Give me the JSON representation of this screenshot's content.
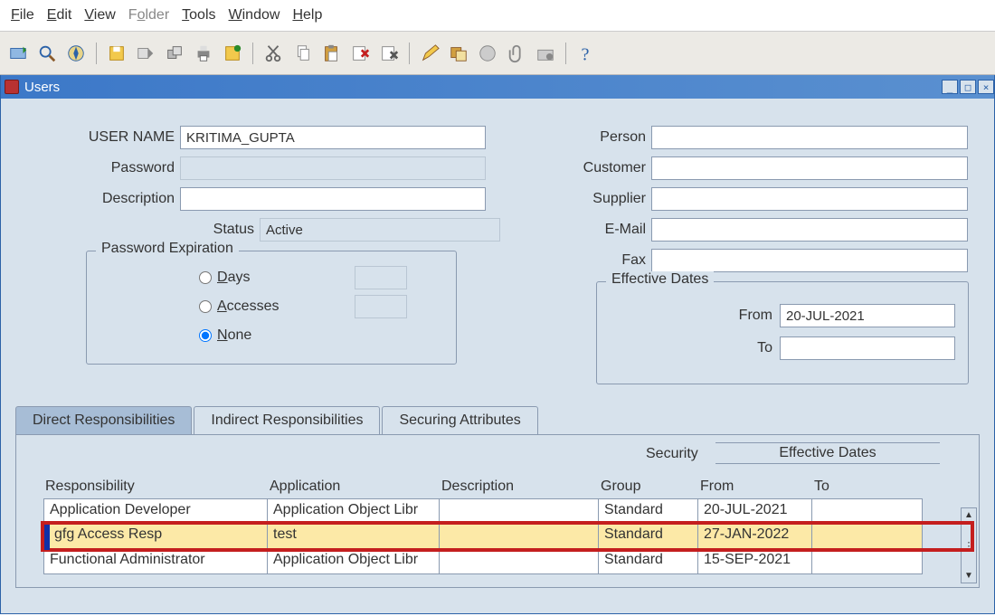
{
  "menu": {
    "file": "File",
    "edit": "Edit",
    "view": "View",
    "folder": "Folder",
    "tools": "Tools",
    "window": "Window",
    "help": "Help"
  },
  "window_title": "Users",
  "labels": {
    "user_name": "USER NAME",
    "password": "Password",
    "description": "Description",
    "status": "Status",
    "pw_exp": "Password Expiration",
    "days": "Days",
    "accesses": "Accesses",
    "none": "None",
    "person": "Person",
    "customer": "Customer",
    "supplier": "Supplier",
    "email": "E-Mail",
    "fax": "Fax",
    "eff_dates": "Effective Dates",
    "from": "From",
    "to": "To"
  },
  "values": {
    "user_name": "KRITIMA_GUPTA",
    "status": "Active",
    "eff_from": "20-JUL-2021",
    "eff_to": "",
    "pw_exp_selected": "none"
  },
  "tabs": {
    "direct": "Direct Responsibilities",
    "indirect": "Indirect Responsibilities",
    "securing": "Securing Attributes"
  },
  "grid": {
    "headers": {
      "responsibility": "Responsibility",
      "application": "Application",
      "description": "Description",
      "security_group": "Security",
      "security_group2": "Group",
      "eff_dates": "Effective Dates",
      "from": "From",
      "to": "To"
    },
    "rows": [
      {
        "resp": "Application Developer",
        "app": "Application Object Libr",
        "desc": "",
        "sec": "Standard",
        "from": "20-JUL-2021",
        "to": ""
      },
      {
        "resp": "gfg Access Resp",
        "app": "test",
        "desc": "",
        "sec": "Standard",
        "from": "27-JAN-2022",
        "to": "",
        "highlight": true
      },
      {
        "resp": "Functional Administrator",
        "app": "Application Object Libr",
        "desc": "",
        "sec": "Standard",
        "from": "15-SEP-2021",
        "to": ""
      }
    ]
  }
}
